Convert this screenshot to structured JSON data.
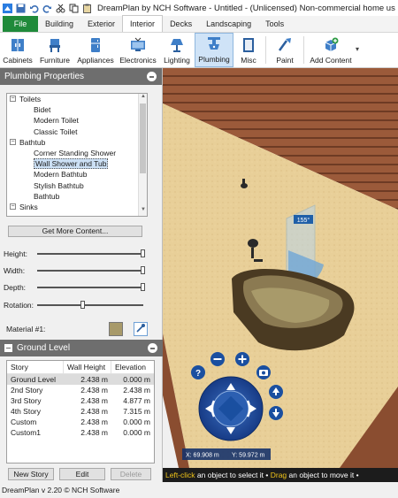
{
  "window": {
    "title": "DreamPlan by NCH Software - Untitled - (Unlicensed) Non-commercial home us"
  },
  "tabs": [
    {
      "label": "File"
    },
    {
      "label": "Building"
    },
    {
      "label": "Exterior"
    },
    {
      "label": "Interior"
    },
    {
      "label": "Decks"
    },
    {
      "label": "Landscaping"
    },
    {
      "label": "Tools"
    }
  ],
  "active_tab": "Interior",
  "ribbon": {
    "items": [
      {
        "label": "Cabinets",
        "icon": "cabinets-icon"
      },
      {
        "label": "Furniture",
        "icon": "furniture-icon"
      },
      {
        "label": "Appliances",
        "icon": "appliances-icon"
      },
      {
        "label": "Electronics",
        "icon": "electronics-icon"
      },
      {
        "label": "Lighting",
        "icon": "lighting-icon"
      },
      {
        "label": "Plumbing",
        "icon": "plumbing-icon"
      },
      {
        "label": "Misc",
        "icon": "misc-icon"
      },
      {
        "label": "Paint",
        "icon": "paint-icon"
      },
      {
        "label": "Add Content",
        "icon": "add-content-icon"
      }
    ],
    "selected": "Plumbing"
  },
  "plumbing_panel": {
    "title": "Plumbing Properties",
    "tree": [
      {
        "label": "Toilets",
        "level": 0,
        "toggle": "−"
      },
      {
        "label": "Bidet",
        "level": 1
      },
      {
        "label": "Modern Toilet",
        "level": 1
      },
      {
        "label": "Classic Toilet",
        "level": 1
      },
      {
        "label": "Bathtub",
        "level": 0,
        "toggle": "−"
      },
      {
        "label": "Corner Standing Shower",
        "level": 1
      },
      {
        "label": "Wall Shower and Tub",
        "level": 1,
        "selected": true
      },
      {
        "label": "Modern Bathtub",
        "level": 1
      },
      {
        "label": "Stylish Bathtub",
        "level": 1
      },
      {
        "label": "Bathtub",
        "level": 1
      },
      {
        "label": "Sinks",
        "level": 0,
        "toggle": "−"
      }
    ],
    "get_more_label": "Get More Content...",
    "height_label": "Height:",
    "width_label": "Width:",
    "depth_label": "Depth:",
    "rotation_label": "Rotation:",
    "height_value": 1.0,
    "width_value": 1.0,
    "depth_value": 1.0,
    "rotation_value": 0.43,
    "material_label": "Material #1:",
    "material_color": "#a89a6a"
  },
  "level_panel": {
    "title": "Ground Level",
    "columns": [
      "Story",
      "Wall Height",
      "Elevation"
    ],
    "rows": [
      {
        "story": "Ground Level",
        "wall_height": "2.438 m",
        "elevation": "0.000 m",
        "selected": true
      },
      {
        "story": "2nd Story",
        "wall_height": "2.438 m",
        "elevation": "2.438 m"
      },
      {
        "story": "3rd Story",
        "wall_height": "2.438 m",
        "elevation": "4.877 m"
      },
      {
        "story": "4th Story",
        "wall_height": "2.438 m",
        "elevation": "7.315 m"
      },
      {
        "story": "Custom",
        "wall_height": "2.438 m",
        "elevation": "0.000 m"
      },
      {
        "story": "Custom1",
        "wall_height": "2.438 m",
        "elevation": "0.000 m"
      }
    ],
    "new_story_label": "New Story",
    "edit_label": "Edit",
    "delete_label": "Delete"
  },
  "viewport": {
    "angle_label": "155°",
    "x_label": "X: 69.908 m",
    "y_label": "Y: 59.972 m"
  },
  "hint": {
    "left_click": "Left-click",
    "part1": " an object to select it • ",
    "drag": "Drag",
    "part2": " an object to move it •"
  },
  "status": {
    "text": "DreamPlan v 2.20 © NCH Software"
  },
  "colors": {
    "file_tab": "#1f8a3a",
    "panel_header": "#6e6e6e",
    "nav_blue": "#1a4fa0",
    "selection": "#cce0f5"
  }
}
